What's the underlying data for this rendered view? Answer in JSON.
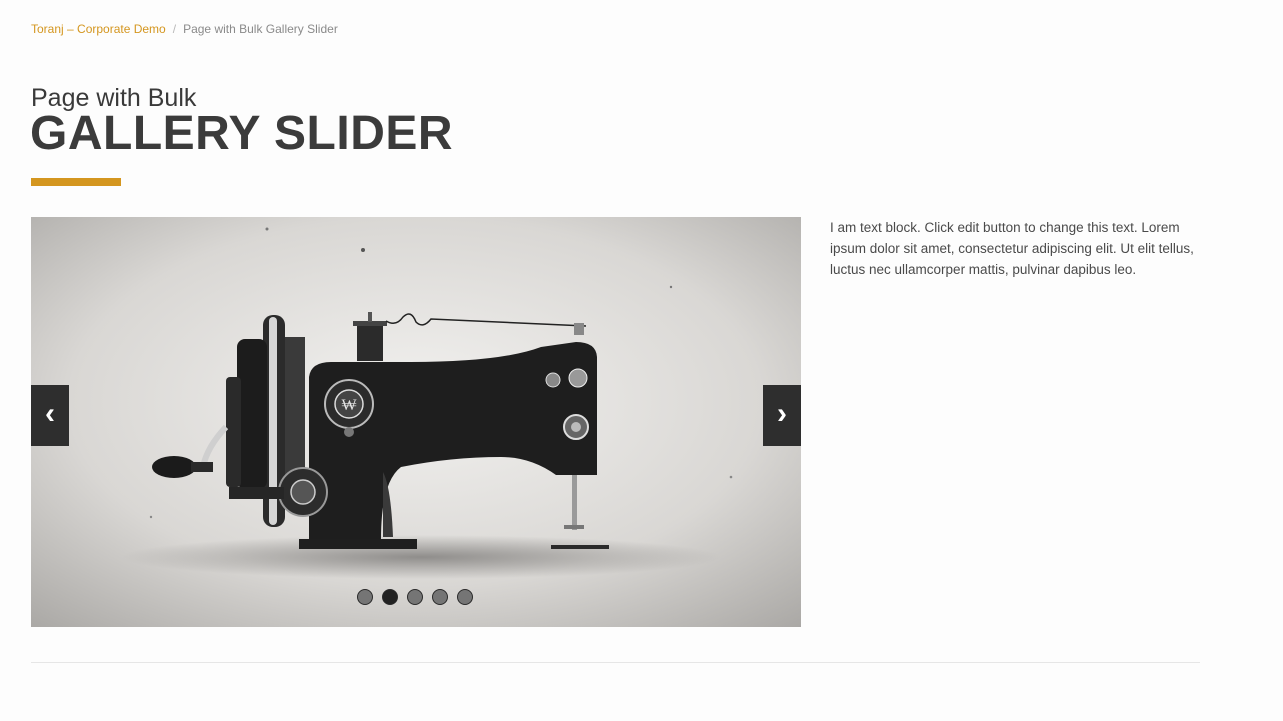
{
  "breadcrumb": {
    "home_label": "Toranj – Corporate Demo",
    "separator": "/",
    "current_label": "Page with Bulk Gallery Slider"
  },
  "header": {
    "subtitle": "Page with Bulk",
    "title": "GALLERY SLIDER",
    "accent_color": "#d4961f"
  },
  "slider": {
    "prev_icon": "chevron-left-icon",
    "prev_glyph": "‹",
    "next_icon": "chevron-right-icon",
    "next_glyph": "›",
    "slide_count": 5,
    "active_index": 1,
    "slide_image_subject": "illustration of a vintage sewing machine"
  },
  "text_block": {
    "paragraph": "I am text block. Click edit button to change this text. Lorem ipsum dolor sit amet, consectetur adipiscing elit. Ut elit tellus, luctus nec ullamcorper mattis, pulvinar dapibus leo."
  }
}
